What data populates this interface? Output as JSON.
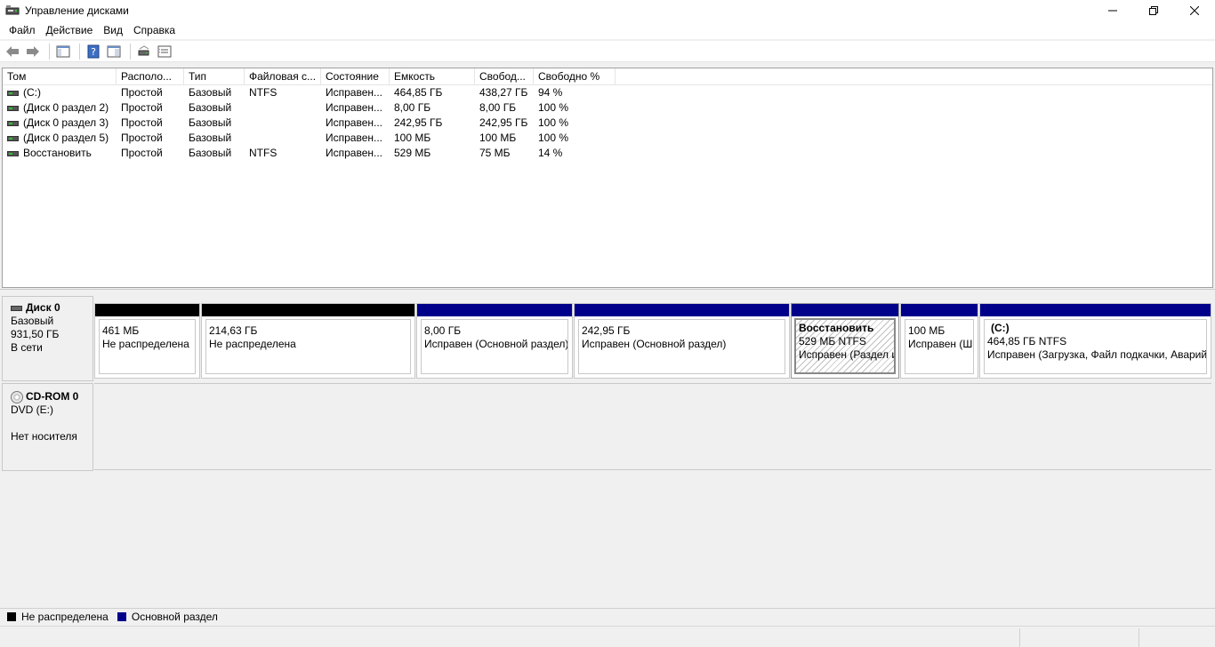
{
  "window": {
    "title": "Управление дисками",
    "controls": {
      "minimize": "—",
      "restore": "❐",
      "close": "✕"
    }
  },
  "menu": [
    {
      "label": "Файл"
    },
    {
      "label": "Действие"
    },
    {
      "label": "Вид"
    },
    {
      "label": "Справка"
    }
  ],
  "toolbar": {
    "icons": [
      "back-arrow-icon",
      "forward-arrow-icon",
      "show-hide-console-tree-icon",
      "help-icon",
      "action-pane-icon",
      "rescan-icon",
      "properties-icon"
    ]
  },
  "colors": {
    "unallocated": "#000000",
    "primary": "#00008b"
  },
  "volume_table": {
    "columns": [
      "Том",
      "Располо...",
      "Тип",
      "Файловая с...",
      "Состояние",
      "Емкость",
      "Свобод...",
      "Свободно %"
    ],
    "rows": [
      [
        "(C:)",
        "Простой",
        "Базовый",
        "NTFS",
        "Исправен...",
        "464,85 ГБ",
        "438,27 ГБ",
        "94 %"
      ],
      [
        "(Диск 0 раздел 2)",
        "Простой",
        "Базовый",
        "",
        "Исправен...",
        "8,00 ГБ",
        "8,00 ГБ",
        "100 %"
      ],
      [
        "(Диск 0 раздел 3)",
        "Простой",
        "Базовый",
        "",
        "Исправен...",
        "242,95 ГБ",
        "242,95 ГБ",
        "100 %"
      ],
      [
        "(Диск 0 раздел 5)",
        "Простой",
        "Базовый",
        "",
        "Исправен...",
        "100 МБ",
        "100 МБ",
        "100 %"
      ],
      [
        "Восстановить",
        "Простой",
        "Базовый",
        "NTFS",
        "Исправен...",
        "529 МБ",
        "75 МБ",
        "14 %"
      ]
    ]
  },
  "disk0": {
    "name": "Диск 0",
    "type": "Базовый",
    "size": "931,50 ГБ",
    "status": "В сети",
    "partitions": [
      {
        "kind": "unallocated",
        "name": "",
        "size": "461 МБ",
        "status": "Не распределена"
      },
      {
        "kind": "unallocated",
        "name": "",
        "size": "214,63 ГБ",
        "status": "Не распределена"
      },
      {
        "kind": "primary",
        "name": "",
        "size": "8,00 ГБ",
        "status": "Исправен (Основной раздел)"
      },
      {
        "kind": "primary",
        "name": "",
        "size": "242,95 ГБ",
        "status": "Исправен (Основной раздел)"
      },
      {
        "kind": "primary",
        "name": "Восстановить",
        "size": "529 МБ NTFS",
        "status": "Исправен (Раздел и",
        "selected": true
      },
      {
        "kind": "primary",
        "name": "",
        "size": "100 МБ",
        "status": "Исправен (Ш"
      },
      {
        "kind": "primary",
        "name": "(C:)",
        "size": "464,85 ГБ NTFS",
        "status": "Исправен (Загрузка, Файл подкачки, Аварий"
      }
    ]
  },
  "cdrom0": {
    "name": "CD-ROM 0",
    "drive": "DVD (E:)",
    "status": "Нет носителя"
  },
  "legend": [
    {
      "label": "Не распределена",
      "color": "#000000"
    },
    {
      "label": "Основной раздел",
      "color": "#00008b"
    }
  ]
}
